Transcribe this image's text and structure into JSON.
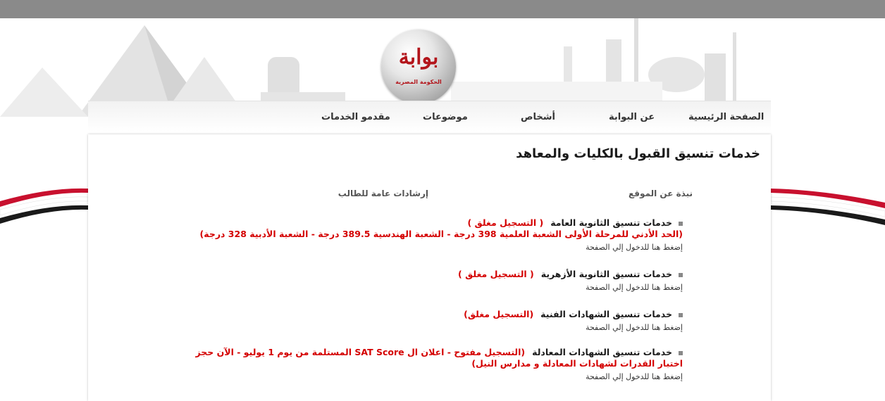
{
  "logo": {
    "name": "بوابة",
    "subtitle": "الحكومة المصرية"
  },
  "nav": {
    "items": [
      {
        "label": "الصفحة الرئيسية"
      },
      {
        "label": "عن البوابة"
      },
      {
        "label": "أشخاص"
      },
      {
        "label": "موضوعات"
      },
      {
        "label": "مقدمو الخدمات"
      }
    ]
  },
  "page": {
    "title": "خدمات تنسيق القبول بالكليات والمعاهد",
    "links": {
      "about": "نبذة عن الموقع",
      "guidance": "إرشادات عامة للطالب"
    }
  },
  "services": [
    {
      "title": "خدمات تنسيق الثانوية العامة",
      "status": "( التسجيل مغلق )",
      "note": "(الحد الأدني للمرحلة الأولى الشعبة العلمية 398 درجة - الشعبة الهندسية 389.5 درجة - الشعبة الأدبية 328 درجة)",
      "link": "إضغط هنا للدخول إلي الصفحة"
    },
    {
      "title": "خدمات تنسيق الثانوية الأزهرية",
      "status": "( التسجيل مغلق )",
      "note": "",
      "link": "إضغط هنا للدخول إلي الصفحة"
    },
    {
      "title": "خدمات تنسيق الشهادات الفنية",
      "status": "(التسجيل مغلق)",
      "note": "",
      "link": "إضغط هنا للدخول إلي الصفحة"
    },
    {
      "title": "خدمات تنسيق الشهادات المعادلة",
      "status": "(التسجيل مفتوح - اعلان ال SAT Score المستلمة من يوم 1 يوليو - الآن حجز اختبار القدرات لشهادات المعادلة و مدارس النيل)",
      "note": "",
      "link": "إضغط هنا للدخول إلي الصفحة"
    }
  ],
  "colors": {
    "topbar": "#8a8a8a",
    "accent_red": "#d40000",
    "logo_red": "#b3151b"
  }
}
